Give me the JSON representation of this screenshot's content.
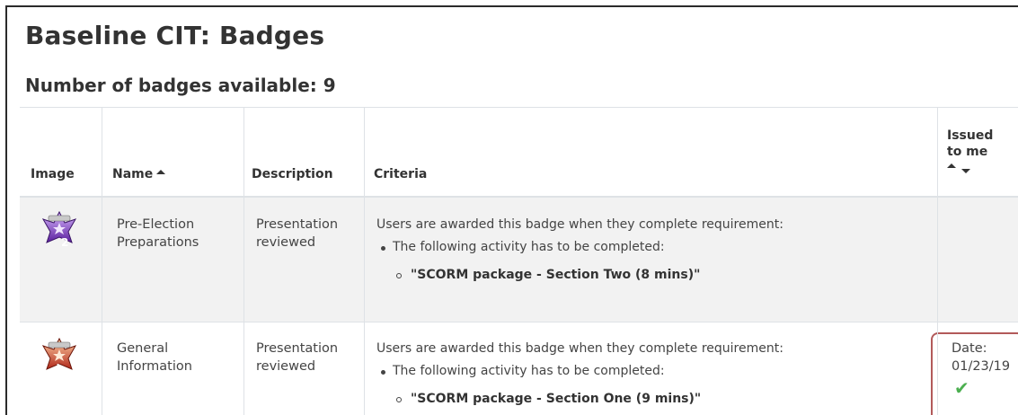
{
  "page": {
    "title": "Baseline CIT: Badges",
    "subtitle": "Number of badges available: 9"
  },
  "table": {
    "columns": {
      "image": "Image",
      "name": "Name",
      "description": "Description",
      "criteria": "Criteria",
      "issued_line1": "Issued",
      "issued_line2": "to me"
    },
    "rows": [
      {
        "badge_icon": "purple-star-badge-icon",
        "name_line1": "Pre-Election",
        "name_line2": "Preparations",
        "description_line1": "Presentation",
        "description_line2": "reviewed",
        "criteria_intro": "Users are awarded this badge when they complete requirement:",
        "criteria_bullet": "The following activity has to be completed:",
        "criteria_activity": "\"SCORM package - Section Two (8 mins)\"",
        "issued_label": "",
        "issued_date": ""
      },
      {
        "badge_icon": "red-star-badge-icon",
        "name_line1": "General",
        "name_line2": "Information",
        "description_line1": "Presentation",
        "description_line2": "reviewed",
        "criteria_intro": "Users are awarded this badge when they complete requirement:",
        "criteria_bullet": "The following activity has to be completed:",
        "criteria_activity": "\"SCORM package - Section One (9 mins)\"",
        "issued_label": "Date:",
        "issued_date": "01/23/19",
        "issued_icon": "checkmark-icon"
      }
    ]
  },
  "colors": {
    "highlight_border": "#b25a5a",
    "check": "#4caf50",
    "row_alt": "#f2f2f2"
  }
}
